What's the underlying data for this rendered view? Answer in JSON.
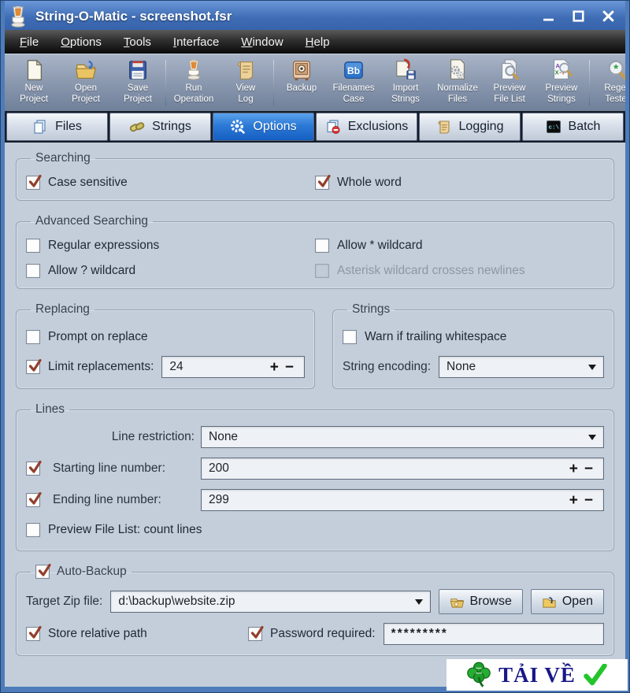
{
  "window": {
    "title": "String-O-Matic - screenshot.fsr"
  },
  "menu": {
    "items": [
      "File",
      "Options",
      "Tools",
      "Interface",
      "Window",
      "Help"
    ]
  },
  "toolbar": {
    "items": [
      {
        "icon": "new-project-icon",
        "label": "New\nProject"
      },
      {
        "icon": "open-project-icon",
        "label": "Open\nProject"
      },
      {
        "icon": "save-project-icon",
        "label": "Save\nProject"
      },
      {
        "icon": "run-operation-icon",
        "label": "Run\nOperation"
      },
      {
        "icon": "view-log-icon",
        "label": "View\nLog"
      },
      {
        "icon": "backup-icon",
        "label": "Backup"
      },
      {
        "icon": "filenames-case-icon",
        "label": "Filenames\nCase"
      },
      {
        "icon": "import-strings-icon",
        "label": "Import\nStrings"
      },
      {
        "icon": "normalize-files-icon",
        "label": "Normalize\nFiles"
      },
      {
        "icon": "preview-file-list-icon",
        "label": "Preview\nFile List"
      },
      {
        "icon": "preview-strings-icon",
        "label": "Preview\nStrings"
      },
      {
        "icon": "regex-tester-icon",
        "label": "Regex\nTester"
      }
    ]
  },
  "tabs": [
    {
      "label": "Files",
      "selected": false
    },
    {
      "label": "Strings",
      "selected": false
    },
    {
      "label": "Options",
      "selected": true
    },
    {
      "label": "Exclusions",
      "selected": false
    },
    {
      "label": "Logging",
      "selected": false
    },
    {
      "label": "Batch",
      "selected": false
    }
  ],
  "controls": {
    "plus": "+",
    "minus": "−"
  },
  "panels": {
    "searching": {
      "title": "Searching",
      "case_sensitive": {
        "label": "Case sensitive",
        "checked": true
      },
      "whole_word": {
        "label": "Whole word",
        "checked": true
      }
    },
    "advanced": {
      "title": "Advanced Searching",
      "regular_expressions": {
        "label": "Regular expressions",
        "checked": false
      },
      "allow_star": {
        "label": "Allow * wildcard",
        "checked": false
      },
      "allow_question": {
        "label": "Allow ? wildcard",
        "checked": false
      },
      "asterisk_newlines": {
        "label": "Asterisk wildcard crosses newlines",
        "checked": false,
        "disabled": true
      }
    },
    "replacing": {
      "title": "Replacing",
      "prompt_on_replace": {
        "label": "Prompt on replace",
        "checked": false
      },
      "limit_replacements": {
        "label": "Limit replacements:",
        "checked": true,
        "value": "24"
      }
    },
    "strings": {
      "title": "Strings",
      "warn_trailing": {
        "label": "Warn if trailing whitespace",
        "checked": false
      },
      "string_encoding": {
        "label": "String encoding:",
        "value": "None"
      }
    },
    "lines": {
      "title": "Lines",
      "line_restriction": {
        "label": "Line restriction:",
        "value": "None"
      },
      "starting_line": {
        "label": "Starting line number:",
        "checked": true,
        "value": "200"
      },
      "ending_line": {
        "label": "Ending line number:",
        "checked": true,
        "value": "299"
      },
      "preview_count": {
        "label": "Preview File List: count lines",
        "checked": false
      }
    },
    "backup": {
      "title": "Auto-Backup",
      "checked": true,
      "target_zip": {
        "label": "Target Zip file:",
        "value": "d:\\backup\\website.zip"
      },
      "browse_label": "Browse",
      "open_label": "Open",
      "store_relative": {
        "label": "Store relative path",
        "checked": true
      },
      "password": {
        "label": "Password required:",
        "checked": true,
        "value": "*********"
      }
    }
  },
  "watermark": {
    "text": "TẢI VỀ"
  },
  "colors": {
    "titlebar": "#3e6cb4",
    "selected_tab": "#2c7ad8",
    "checkmark": "#933f2c",
    "panel": "#c3ceda"
  }
}
